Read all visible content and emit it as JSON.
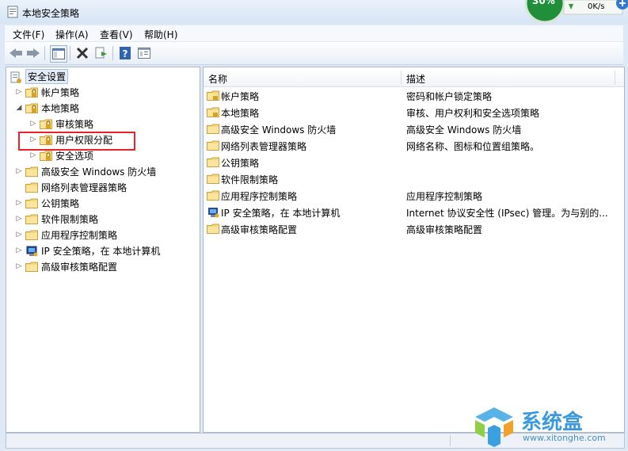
{
  "window": {
    "title": "本地安全策略"
  },
  "menu": [
    "文件(F)",
    "操作(A)",
    "查看(V)",
    "帮助(H)"
  ],
  "toolbar": [
    "back-icon",
    "forward-icon",
    "show-hide-tree-icon",
    "delete-icon",
    "export-list-icon",
    "help-icon",
    "properties-icon"
  ],
  "net_widget": {
    "percent": "30%",
    "speed": "0K/s"
  },
  "tree": {
    "root": "安全设置",
    "items": [
      {
        "label": "帐户策略",
        "level": 1,
        "expander": "▷"
      },
      {
        "label": "本地策略",
        "level": 1,
        "expander": "◢"
      },
      {
        "label": "审核策略",
        "level": 2,
        "expander": "▷"
      },
      {
        "label": "用户权限分配",
        "level": 2,
        "expander": "▷"
      },
      {
        "label": "安全选项",
        "level": 2,
        "expander": "▷"
      },
      {
        "label": "高级安全 Windows 防火墙",
        "level": 1,
        "expander": "▷"
      },
      {
        "label": "网络列表管理器策略",
        "level": 1,
        "expander": ""
      },
      {
        "label": "公钥策略",
        "level": 1,
        "expander": "▷"
      },
      {
        "label": "软件限制策略",
        "level": 1,
        "expander": "▷"
      },
      {
        "label": "应用程序控制策略",
        "level": 1,
        "expander": "▷"
      },
      {
        "label": "IP 安全策略，在 本地计算机",
        "level": 1,
        "expander": "▷"
      },
      {
        "label": "高级审核策略配置",
        "level": 1,
        "expander": "▷"
      }
    ]
  },
  "list": {
    "columns": [
      "名称",
      "描述"
    ],
    "rows": [
      {
        "name": "帐户策略",
        "desc": "密码和帐户锁定策略"
      },
      {
        "name": "本地策略",
        "desc": "审核、用户权利和安全选项策略"
      },
      {
        "name": "高级安全 Windows 防火墙",
        "desc": "高级安全 Windows 防火墙"
      },
      {
        "name": "网络列表管理器策略",
        "desc": "网络名称、图标和位置组策略。"
      },
      {
        "name": "公钥策略",
        "desc": ""
      },
      {
        "name": "软件限制策略",
        "desc": ""
      },
      {
        "name": "应用程序控制策略",
        "desc": "应用程序控制策略"
      },
      {
        "name": "IP 安全策略，在 本地计算机",
        "desc": "Internet 协议安全性 (IPsec) 管理。为与别的..."
      },
      {
        "name": "高级审核策略配置",
        "desc": "高级审核策略配置"
      }
    ]
  },
  "watermark": {
    "text": "系统盒",
    "url": "www.xitonghe.com"
  }
}
